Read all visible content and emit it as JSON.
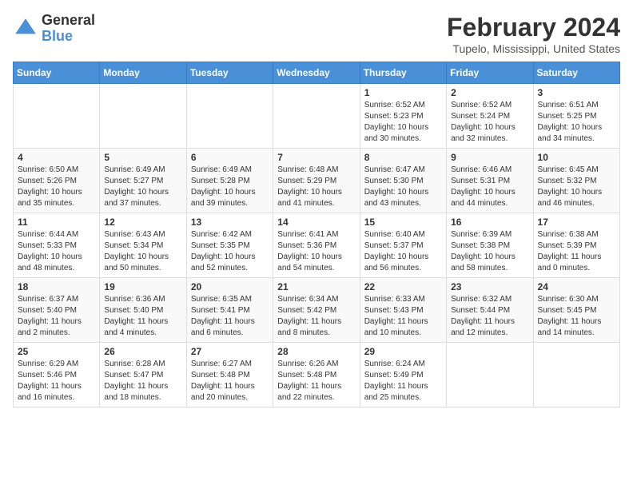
{
  "header": {
    "logo_general": "General",
    "logo_blue": "Blue",
    "month_title": "February 2024",
    "location": "Tupelo, Mississippi, United States"
  },
  "days_of_week": [
    "Sunday",
    "Monday",
    "Tuesday",
    "Wednesday",
    "Thursday",
    "Friday",
    "Saturday"
  ],
  "weeks": [
    [
      {
        "day": "",
        "info": ""
      },
      {
        "day": "",
        "info": ""
      },
      {
        "day": "",
        "info": ""
      },
      {
        "day": "",
        "info": ""
      },
      {
        "day": "1",
        "info": "Sunrise: 6:52 AM\nSunset: 5:23 PM\nDaylight: 10 hours\nand 30 minutes."
      },
      {
        "day": "2",
        "info": "Sunrise: 6:52 AM\nSunset: 5:24 PM\nDaylight: 10 hours\nand 32 minutes."
      },
      {
        "day": "3",
        "info": "Sunrise: 6:51 AM\nSunset: 5:25 PM\nDaylight: 10 hours\nand 34 minutes."
      }
    ],
    [
      {
        "day": "4",
        "info": "Sunrise: 6:50 AM\nSunset: 5:26 PM\nDaylight: 10 hours\nand 35 minutes."
      },
      {
        "day": "5",
        "info": "Sunrise: 6:49 AM\nSunset: 5:27 PM\nDaylight: 10 hours\nand 37 minutes."
      },
      {
        "day": "6",
        "info": "Sunrise: 6:49 AM\nSunset: 5:28 PM\nDaylight: 10 hours\nand 39 minutes."
      },
      {
        "day": "7",
        "info": "Sunrise: 6:48 AM\nSunset: 5:29 PM\nDaylight: 10 hours\nand 41 minutes."
      },
      {
        "day": "8",
        "info": "Sunrise: 6:47 AM\nSunset: 5:30 PM\nDaylight: 10 hours\nand 43 minutes."
      },
      {
        "day": "9",
        "info": "Sunrise: 6:46 AM\nSunset: 5:31 PM\nDaylight: 10 hours\nand 44 minutes."
      },
      {
        "day": "10",
        "info": "Sunrise: 6:45 AM\nSunset: 5:32 PM\nDaylight: 10 hours\nand 46 minutes."
      }
    ],
    [
      {
        "day": "11",
        "info": "Sunrise: 6:44 AM\nSunset: 5:33 PM\nDaylight: 10 hours\nand 48 minutes."
      },
      {
        "day": "12",
        "info": "Sunrise: 6:43 AM\nSunset: 5:34 PM\nDaylight: 10 hours\nand 50 minutes."
      },
      {
        "day": "13",
        "info": "Sunrise: 6:42 AM\nSunset: 5:35 PM\nDaylight: 10 hours\nand 52 minutes."
      },
      {
        "day": "14",
        "info": "Sunrise: 6:41 AM\nSunset: 5:36 PM\nDaylight: 10 hours\nand 54 minutes."
      },
      {
        "day": "15",
        "info": "Sunrise: 6:40 AM\nSunset: 5:37 PM\nDaylight: 10 hours\nand 56 minutes."
      },
      {
        "day": "16",
        "info": "Sunrise: 6:39 AM\nSunset: 5:38 PM\nDaylight: 10 hours\nand 58 minutes."
      },
      {
        "day": "17",
        "info": "Sunrise: 6:38 AM\nSunset: 5:39 PM\nDaylight: 11 hours\nand 0 minutes."
      }
    ],
    [
      {
        "day": "18",
        "info": "Sunrise: 6:37 AM\nSunset: 5:40 PM\nDaylight: 11 hours\nand 2 minutes."
      },
      {
        "day": "19",
        "info": "Sunrise: 6:36 AM\nSunset: 5:40 PM\nDaylight: 11 hours\nand 4 minutes."
      },
      {
        "day": "20",
        "info": "Sunrise: 6:35 AM\nSunset: 5:41 PM\nDaylight: 11 hours\nand 6 minutes."
      },
      {
        "day": "21",
        "info": "Sunrise: 6:34 AM\nSunset: 5:42 PM\nDaylight: 11 hours\nand 8 minutes."
      },
      {
        "day": "22",
        "info": "Sunrise: 6:33 AM\nSunset: 5:43 PM\nDaylight: 11 hours\nand 10 minutes."
      },
      {
        "day": "23",
        "info": "Sunrise: 6:32 AM\nSunset: 5:44 PM\nDaylight: 11 hours\nand 12 minutes."
      },
      {
        "day": "24",
        "info": "Sunrise: 6:30 AM\nSunset: 5:45 PM\nDaylight: 11 hours\nand 14 minutes."
      }
    ],
    [
      {
        "day": "25",
        "info": "Sunrise: 6:29 AM\nSunset: 5:46 PM\nDaylight: 11 hours\nand 16 minutes."
      },
      {
        "day": "26",
        "info": "Sunrise: 6:28 AM\nSunset: 5:47 PM\nDaylight: 11 hours\nand 18 minutes."
      },
      {
        "day": "27",
        "info": "Sunrise: 6:27 AM\nSunset: 5:48 PM\nDaylight: 11 hours\nand 20 minutes."
      },
      {
        "day": "28",
        "info": "Sunrise: 6:26 AM\nSunset: 5:48 PM\nDaylight: 11 hours\nand 22 minutes."
      },
      {
        "day": "29",
        "info": "Sunrise: 6:24 AM\nSunset: 5:49 PM\nDaylight: 11 hours\nand 25 minutes."
      },
      {
        "day": "",
        "info": ""
      },
      {
        "day": "",
        "info": ""
      }
    ]
  ]
}
